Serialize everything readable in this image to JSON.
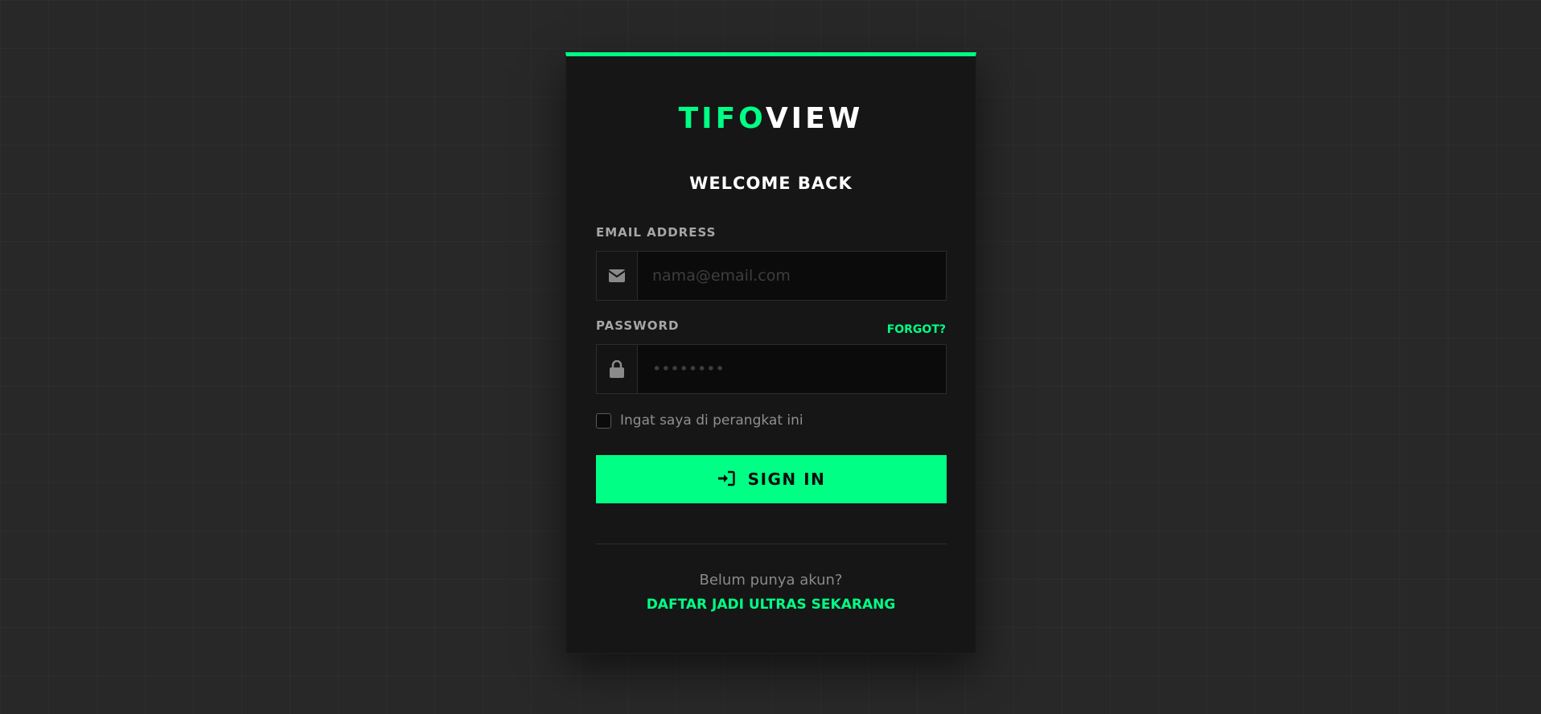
{
  "brand": {
    "part1": "TIFO",
    "part2": "VIEW",
    "accent_color": "#00ff85"
  },
  "heading": "WELCOME BACK",
  "email": {
    "label": "EMAIL ADDRESS",
    "placeholder": "nama@email.com",
    "value": "",
    "icon": "envelope-icon"
  },
  "password": {
    "label": "PASSWORD",
    "forgot_label": "FORGOT?",
    "placeholder": "••••••••",
    "value": "",
    "icon": "lock-icon"
  },
  "remember": {
    "label": "Ingat saya di perangkat ini",
    "checked": false
  },
  "signin": {
    "label": "SIGN IN",
    "icon": "sign-in-icon"
  },
  "footer": {
    "prompt": "Belum punya akun?",
    "register_label": "DAFTAR JADI ULTRAS SEKARANG"
  }
}
